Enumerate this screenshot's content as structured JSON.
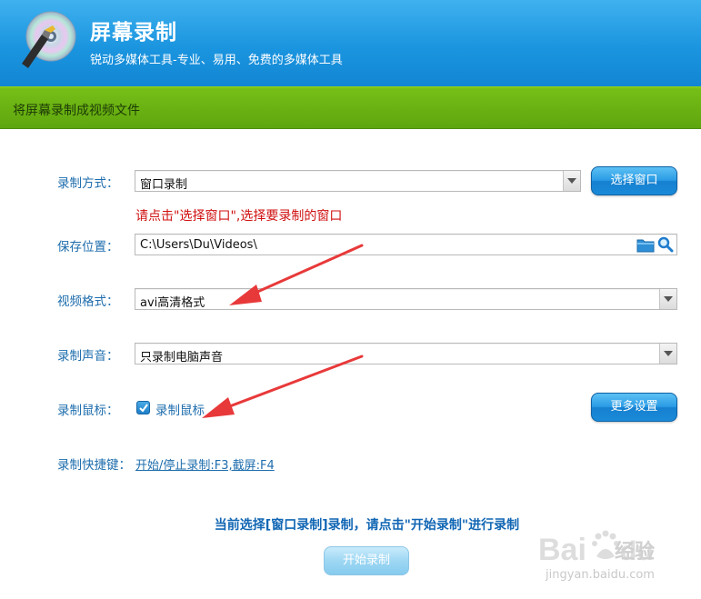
{
  "header": {
    "title": "屏幕录制",
    "subtitle": "锐动多媒体工具-专业、易用、免费的多媒体工具"
  },
  "section": {
    "title": "将屏幕录制成视频文件"
  },
  "form": {
    "record_mode": {
      "label": "录制方式：",
      "value": "窗口录制"
    },
    "select_window_button": "选择窗口",
    "hint": "请点击\"选择窗口\",选择要录制的窗口",
    "save_location": {
      "label": "保存位置：",
      "value": "C:\\Users\\Du\\Videos\\"
    },
    "video_format": {
      "label": "视频格式：",
      "value": "avi高清格式"
    },
    "audio": {
      "label": "录制声音：",
      "value": "只录制电脑声音"
    },
    "mouse": {
      "label": "录制鼠标：",
      "checkbox_label": "录制鼠标",
      "checked": true
    },
    "more_settings_button": "更多设置",
    "shortcut": {
      "label": "录制快捷键：",
      "value": "开始/停止录制:F3,截屏:F4"
    }
  },
  "status_text": "当前选择[窗口录制]录制，请点击\"开始录制\"进行录制",
  "start_button": "开始录制",
  "watermark": {
    "brand": "Baidu经验",
    "url": "jingyan.baidu.com"
  },
  "colors": {
    "header": "#1b95df",
    "greenbar": "#5ea60e",
    "label": "#1e6dad",
    "hint": "#d01010",
    "arrow": "#e8393a"
  }
}
